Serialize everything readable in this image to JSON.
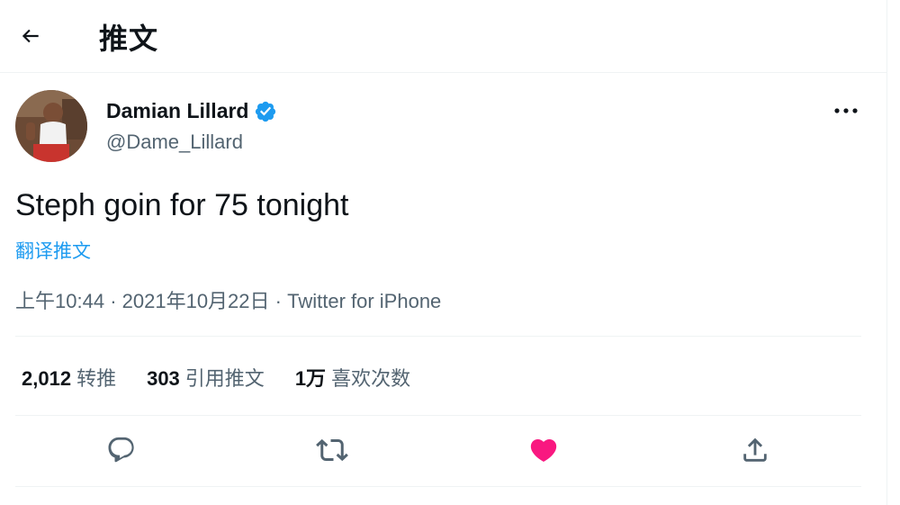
{
  "header": {
    "title": "推文",
    "back_icon": "arrow-left-icon"
  },
  "tweet": {
    "author": {
      "display_name": "Damian Lillard",
      "handle": "@Dame_Lillard",
      "verified": true
    },
    "text": "Steph goin for 75 tonight",
    "translate_label": "翻译推文",
    "time": "上午10:44",
    "separator": "·",
    "date": "2021年10月22日",
    "source": "Twitter for iPhone"
  },
  "stats": {
    "retweets": {
      "count": "2,012",
      "label": "转推"
    },
    "quotes": {
      "count": "303",
      "label": "引用推文"
    },
    "likes": {
      "count": "1万",
      "label": "喜欢次数"
    }
  },
  "actions": [
    {
      "name": "reply",
      "icon": "reply-icon"
    },
    {
      "name": "retweet",
      "icon": "retweet-icon"
    },
    {
      "name": "like",
      "icon": "heart-icon",
      "active": true
    },
    {
      "name": "share",
      "icon": "share-icon"
    }
  ],
  "colors": {
    "accent": "#1d9bf0",
    "like": "#f91880",
    "text": "#0f1419",
    "secondary": "#536471"
  }
}
